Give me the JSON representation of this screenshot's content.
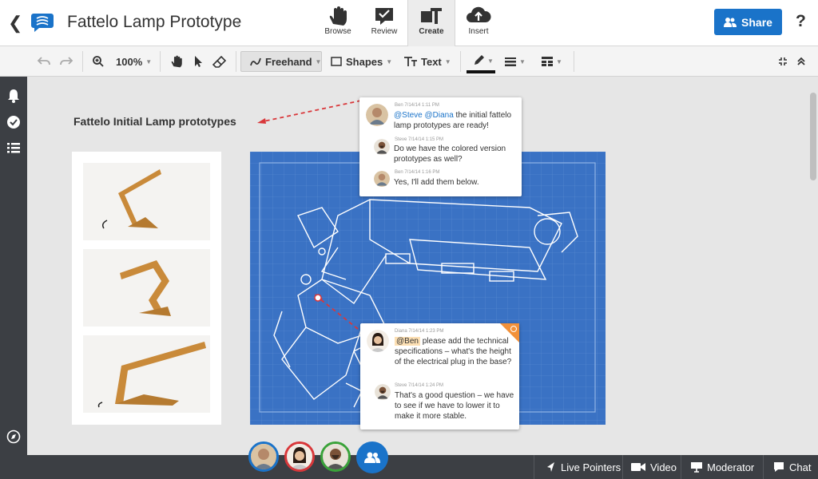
{
  "header": {
    "title": "Fattelo Lamp Prototype",
    "modes": [
      {
        "label": "Browse",
        "icon": "hand-icon"
      },
      {
        "label": "Review",
        "icon": "review-icon"
      },
      {
        "label": "Create",
        "icon": "create-icon"
      },
      {
        "label": "Insert",
        "icon": "cloud-upload-icon"
      }
    ],
    "share_label": "Share",
    "help_label": "?"
  },
  "toolbar": {
    "zoom": "100%",
    "freehand_label": "Freehand",
    "shapes_label": "Shapes",
    "text_label": "Text"
  },
  "canvas": {
    "title": "Fattelo Initial Lamp prototypes"
  },
  "comments_top": [
    {
      "author": "Ben",
      "meta": "Ben 7/14/14 1:11 PM",
      "mentions": "@Steve @Diana",
      "text": " the initial fattelo lamp prototypes are ready!"
    },
    {
      "author": "Steve",
      "meta": "Steve 7/14/14 1:15 PM",
      "text": "Do we have the colored version prototypes as well?"
    },
    {
      "author": "Ben",
      "meta": "Ben 7/14/14 1:16 PM",
      "text": "Yes, I'll add them below."
    }
  ],
  "comments_bottom": [
    {
      "author": "Diana",
      "meta": "Diana 7/14/14 1:23 PM",
      "mention": "@Ben",
      "text": " please add the technical specifications – what's the height of the electrical plug in the base?"
    },
    {
      "author": "Steve",
      "meta": "Steve 7/14/14 1:24 PM",
      "text": "That's a good question – we have to see if we have to lower it to make it more stable."
    }
  ],
  "bottombar": {
    "live_pointers": "Live Pointers",
    "video": "Video",
    "moderator": "Moderator",
    "chat": "Chat"
  },
  "colors": {
    "accent": "#1a73c9",
    "blueprint": "#3a72c4",
    "participant_rings": [
      "#1a73c9",
      "#d9373a",
      "#3aa33a"
    ]
  }
}
